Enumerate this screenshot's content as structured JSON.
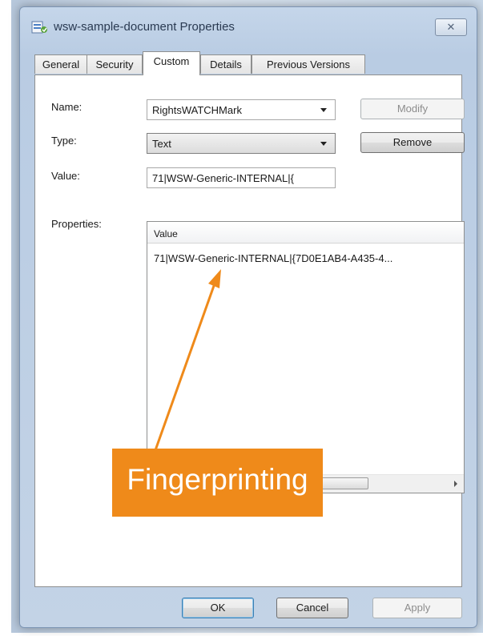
{
  "window": {
    "title": "wsw-sample-document Properties",
    "close_glyph": "✕"
  },
  "tabs": [
    {
      "label": "General",
      "active": false
    },
    {
      "label": "Security",
      "active": false
    },
    {
      "label": "Custom",
      "active": true
    },
    {
      "label": "Details",
      "active": false
    },
    {
      "label": "Previous Versions",
      "active": false
    }
  ],
  "custom": {
    "name_label": "Name:",
    "name_value": "RightsWATCHMark",
    "type_label": "Type:",
    "type_value": "Text",
    "value_label": "Value:",
    "value_value": "71|WSW-Generic-INTERNAL|{",
    "modify_label": "Modify",
    "remove_label": "Remove",
    "properties_label": "Properties:",
    "list_header_value": "Value",
    "list_rows": [
      "71|WSW-Generic-INTERNAL|{7D0E1AB4-A435-4..."
    ]
  },
  "callout": {
    "text": "Fingerprinting",
    "color": "#ef8a1a"
  },
  "buttons": {
    "ok": "OK",
    "cancel": "Cancel",
    "apply": "Apply"
  },
  "icons": {
    "title": "document-properties-icon",
    "scroll_left": "scroll-left-arrow-icon",
    "scroll_right": "scroll-right-arrow-icon"
  }
}
